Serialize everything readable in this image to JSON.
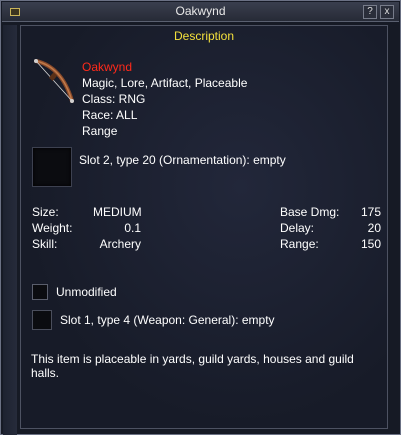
{
  "window": {
    "title": "Oakwynd"
  },
  "titlebar": {
    "help_label": "?",
    "close_label": "x"
  },
  "panel": {
    "header": "Description"
  },
  "item": {
    "name": "Oakwynd",
    "tags": "Magic, Lore, Artifact, Placeable",
    "class": "Class: RNG",
    "race": "Race: ALL",
    "type": "Range",
    "icon": "bow-icon"
  },
  "slots": {
    "ornament": "Slot 2, type 20 (Ornamentation): empty",
    "weapon": "Slot 1, type 4 (Weapon: General): empty"
  },
  "stats": {
    "size_label": "Size:",
    "size_value": "MEDIUM",
    "weight_label": "Weight:",
    "weight_value": "0.1",
    "skill_label": "Skill:",
    "skill_value": "Archery",
    "base_dmg_label": "Base Dmg:",
    "base_dmg_value": "175",
    "delay_label": "Delay:",
    "delay_value": "20",
    "range_label": "Range:",
    "range_value": "150"
  },
  "augment": {
    "label": "Unmodified"
  },
  "description": "This item is placeable in yards, guild yards, houses and guild halls.",
  "colors": {
    "title_text": "#e8e8e8",
    "header_text": "#f3e03c",
    "item_name": "#ff2a1a",
    "body_text": "#ffffff",
    "panel_bg": "#171b28"
  }
}
